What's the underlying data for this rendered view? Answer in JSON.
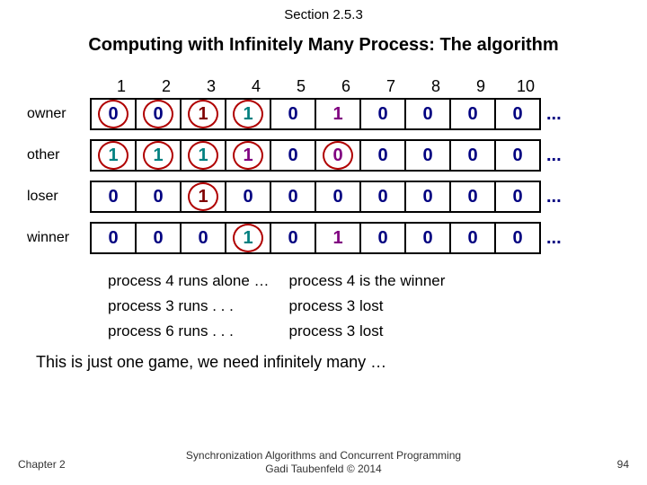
{
  "section": "Section 2.5.3",
  "title": "Computing with Infinitely Many Process: The algorithm",
  "cols": [
    "1",
    "2",
    "3",
    "4",
    "5",
    "6",
    "7",
    "8",
    "9",
    "10"
  ],
  "rows": [
    {
      "label": "owner",
      "cells": [
        {
          "v": "0",
          "cls": "navy",
          "circ": true
        },
        {
          "v": "0",
          "cls": "navy",
          "circ": true
        },
        {
          "v": "1",
          "cls": "maroon",
          "circ": true
        },
        {
          "v": "1",
          "cls": "teal",
          "circ": true
        },
        {
          "v": "0",
          "cls": "navy",
          "circ": false
        },
        {
          "v": "1",
          "cls": "purple",
          "circ": false
        },
        {
          "v": "0",
          "cls": "navy",
          "circ": false
        },
        {
          "v": "0",
          "cls": "navy",
          "circ": false
        },
        {
          "v": "0",
          "cls": "navy",
          "circ": false
        },
        {
          "v": "0",
          "cls": "navy",
          "circ": false
        }
      ]
    },
    {
      "label": "other",
      "cells": [
        {
          "v": "1",
          "cls": "teal",
          "circ": true
        },
        {
          "v": "1",
          "cls": "teal",
          "circ": true
        },
        {
          "v": "1",
          "cls": "teal",
          "circ": true
        },
        {
          "v": "1",
          "cls": "purple",
          "circ": true
        },
        {
          "v": "0",
          "cls": "navy",
          "circ": false
        },
        {
          "v": "0",
          "cls": "purple",
          "circ": true
        },
        {
          "v": "0",
          "cls": "navy",
          "circ": false
        },
        {
          "v": "0",
          "cls": "navy",
          "circ": false
        },
        {
          "v": "0",
          "cls": "navy",
          "circ": false
        },
        {
          "v": "0",
          "cls": "navy",
          "circ": false
        }
      ]
    },
    {
      "label": "loser",
      "cells": [
        {
          "v": "0",
          "cls": "navy",
          "circ": false
        },
        {
          "v": "0",
          "cls": "navy",
          "circ": false
        },
        {
          "v": "1",
          "cls": "maroon",
          "circ": true
        },
        {
          "v": "0",
          "cls": "navy",
          "circ": false
        },
        {
          "v": "0",
          "cls": "navy",
          "circ": false
        },
        {
          "v": "0",
          "cls": "navy",
          "circ": false
        },
        {
          "v": "0",
          "cls": "navy",
          "circ": false
        },
        {
          "v": "0",
          "cls": "navy",
          "circ": false
        },
        {
          "v": "0",
          "cls": "navy",
          "circ": false
        },
        {
          "v": "0",
          "cls": "navy",
          "circ": false
        }
      ]
    },
    {
      "label": "winner",
      "cells": [
        {
          "v": "0",
          "cls": "navy",
          "circ": false
        },
        {
          "v": "0",
          "cls": "navy",
          "circ": false
        },
        {
          "v": "0",
          "cls": "navy",
          "circ": false
        },
        {
          "v": "1",
          "cls": "teal",
          "circ": true
        },
        {
          "v": "0",
          "cls": "navy",
          "circ": false
        },
        {
          "v": "1",
          "cls": "purple",
          "circ": false
        },
        {
          "v": "0",
          "cls": "navy",
          "circ": false
        },
        {
          "v": "0",
          "cls": "navy",
          "circ": false
        },
        {
          "v": "0",
          "cls": "navy",
          "circ": false
        },
        {
          "v": "0",
          "cls": "navy",
          "circ": false
        }
      ]
    }
  ],
  "ellipsis": "...",
  "notes": [
    {
      "left": "process 4 runs alone …",
      "right": "process 4 is the winner"
    },
    {
      "left": "process 3 runs . . .",
      "right": "process 3 lost"
    },
    {
      "left": "process 6 runs . . .",
      "right": "process 3 lost"
    }
  ],
  "conclusion": "This is just one game, we need infinitely many …",
  "footer": {
    "chapter": "Chapter 2",
    "line1": "Synchronization Algorithms and Concurrent Programming",
    "line2": "Gadi Taubenfeld © 2014",
    "page": "94"
  }
}
